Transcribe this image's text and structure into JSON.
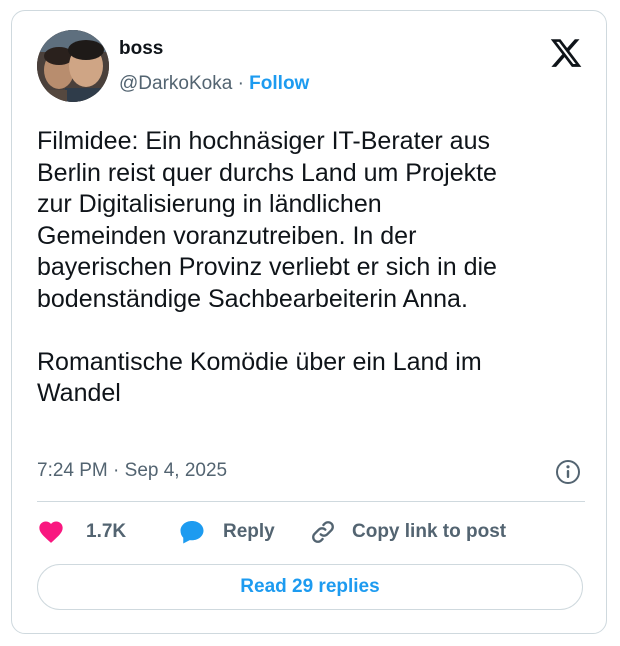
{
  "author": {
    "display_name": "boss",
    "handle": "@DarkoKoka",
    "separator": "·",
    "follow_label": "Follow"
  },
  "tweet": {
    "text": "Filmidee: Ein hochnäsiger IT-Berater aus\nBerlin reist quer durchs Land um Projekte\nzur Digitalisierung in ländlichen\nGemeinden voranzutreiben. In der\nbayerischen Provinz verliebt er sich in die\nbodenständige Sachbearbeiterin Anna.\n\nRomantische Komödie über ein Land im\nWandel",
    "timestamp": "7:24 PM · Sep 4, 2025"
  },
  "actions": {
    "likes": "1.7K",
    "reply_label": "Reply",
    "copy_link_label": "Copy link to post"
  },
  "read_replies_label": "Read 29 replies",
  "icons": {
    "logo": "x-logo-icon",
    "info": "info-icon",
    "like": "heart-icon",
    "reply": "reply-bubble-icon",
    "copy_link": "link-icon"
  },
  "colors": {
    "accent": "#1d9bf0",
    "like": "#f91880",
    "text": "#0f1419",
    "muted": "#536471",
    "border": "#cfd9de"
  }
}
